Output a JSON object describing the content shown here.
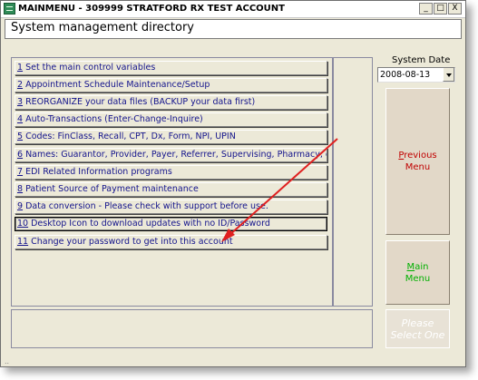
{
  "window": {
    "title": "MAINMENU - 309999 STRATFORD RX TEST ACCOUNT",
    "minimize_glyph": "_",
    "maximize_glyph": "□",
    "close_glyph": "X"
  },
  "header": {
    "title": "System management directory"
  },
  "menu": {
    "items": [
      {
        "num": "1",
        "label": " Set the main control variables"
      },
      {
        "num": "2",
        "label": " Appointment Schedule Maintenance/Setup"
      },
      {
        "num": "3",
        "label": " REORGANIZE your data files (BACKUP your data first)"
      },
      {
        "num": "4",
        "label": " Auto-Transactions (Enter-Change-Inquire)"
      },
      {
        "num": "5",
        "label": " Codes: FinClass, Recall, CPT, Dx, Form, NPI, UPIN"
      },
      {
        "num": "6",
        "label": " Names: Guarantor, Provider, Payer, Referrer, Supervising, Pharmacy, etc"
      },
      {
        "num": "7",
        "label": " EDI Related Information programs"
      },
      {
        "num": "8",
        "label": " Patient Source of Payment maintenance"
      },
      {
        "num": "9",
        "label": " Data conversion - Please check with support before use."
      },
      {
        "num": "10",
        "label": " Desktop Icon to download updates with no ID/Password"
      },
      {
        "num": "11",
        "label": " Change your password to get into this account"
      }
    ]
  },
  "system_date": {
    "label": "System Date",
    "value": "2008-08-13"
  },
  "buttons": {
    "previous_menu": {
      "accel": "P",
      "line1_rest": "revious",
      "line2": "Menu"
    },
    "main_menu": {
      "accel": "M",
      "line1_rest": "ain",
      "line2": "Menu"
    },
    "select_one": {
      "line1": "Please",
      "line2": "Select One"
    }
  },
  "footer": {
    "grip_text": ".."
  },
  "colors": {
    "menu_text": "#14148c",
    "previous_text": "#c00000",
    "main_text": "#00b000",
    "annotation_arrow": "#e02020"
  }
}
